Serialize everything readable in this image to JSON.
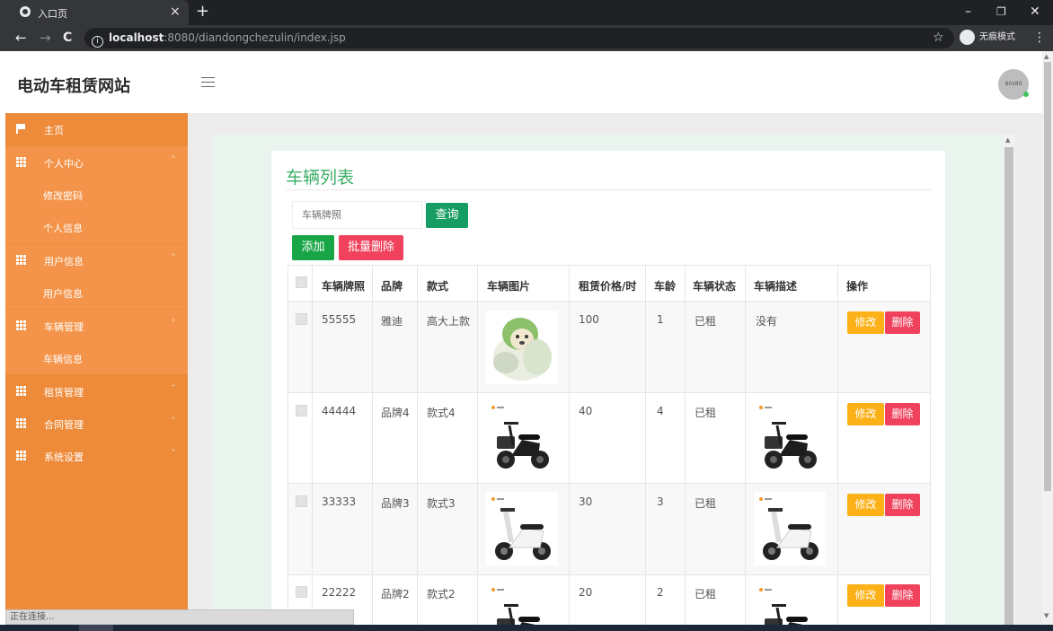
{
  "browser": {
    "tab_title": "入口页",
    "tab_close": "×",
    "new_tab": "+",
    "url_host": "localhost",
    "url_rest": ":8080/diandongchezulin/index.jsp",
    "incognito_label": "无痕模式",
    "window_controls": {
      "minimize": "–",
      "restore": "❐",
      "close": "✕"
    },
    "nav": {
      "back": "←",
      "forward": "→",
      "reload": "C"
    }
  },
  "header": {
    "site_title": "电动车租赁网站",
    "avatar_text": "80x80"
  },
  "sidebar": {
    "items": [
      {
        "label": "主页",
        "icon": "flag-icon"
      },
      {
        "label": "个人中心",
        "icon": "grid-icon",
        "expanded": true,
        "children": [
          "修改密码",
          "个人信息"
        ]
      },
      {
        "label": "用户信息",
        "icon": "grid-icon",
        "expanded": true,
        "children": [
          "用户信息"
        ]
      },
      {
        "label": "车辆管理",
        "icon": "grid-icon",
        "expanded": true,
        "children": [
          "车辆信息"
        ]
      },
      {
        "label": "租赁管理",
        "icon": "grid-icon",
        "expanded": false
      },
      {
        "label": "合同管理",
        "icon": "grid-icon",
        "expanded": false
      },
      {
        "label": "系统设置",
        "icon": "grid-icon",
        "expanded": false
      }
    ],
    "caret_up": "˄",
    "caret_down": "˅"
  },
  "panel": {
    "title": "车辆列表",
    "search_placeholder": "车辆牌照",
    "query_button": "查询",
    "add_button": "添加",
    "batch_delete_button": "批量删除",
    "columns": [
      "车辆牌照",
      "品牌",
      "款式",
      "车辆图片",
      "租赁价格/时",
      "车龄",
      "车辆状态",
      "车辆描述",
      "操作"
    ],
    "rows": [
      {
        "plate": "55555",
        "brand": "雅迪",
        "style": "高大上款",
        "image": "cabbage-dog-photo",
        "price": "100",
        "age": "1",
        "status": "已租",
        "description": "没有",
        "desc_image": null
      },
      {
        "plate": "44444",
        "brand": "品牌4",
        "style": "款式4",
        "image": "black-scooter-photo",
        "price": "40",
        "age": "4",
        "status": "已租",
        "description": "",
        "desc_image": "black-scooter-photo"
      },
      {
        "plate": "33333",
        "brand": "品牌3",
        "style": "款式3",
        "image": "white-scooter-photo",
        "price": "30",
        "age": "3",
        "status": "已租",
        "description": "",
        "desc_image": "white-scooter-photo"
      },
      {
        "plate": "22222",
        "brand": "品牌2",
        "style": "款式2",
        "image": "black-scooter-photo",
        "price": "20",
        "age": "2",
        "status": "已租",
        "description": "",
        "desc_image": "black-scooter-photo"
      }
    ],
    "edit_label": "修改",
    "delete_label": "删除"
  },
  "status_text": "正在连接...",
  "colors": {
    "sidebar": "#ed8b3a",
    "sidebar_open": "#f3944a",
    "title_green": "#3cae67",
    "add_green": "#17a545",
    "query_green": "#179c63",
    "danger": "#f0425c",
    "warning": "#fbb117"
  }
}
